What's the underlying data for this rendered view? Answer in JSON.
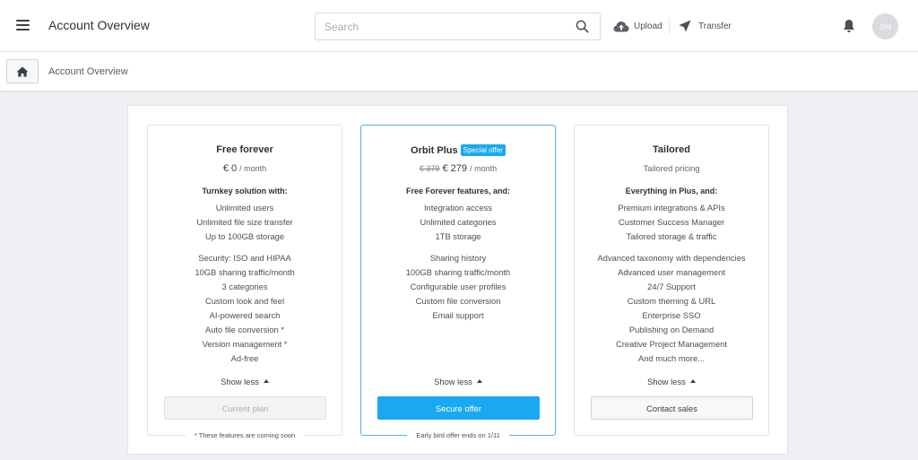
{
  "header": {
    "title": "Account Overview",
    "search_placeholder": "Search",
    "upload_label": "Upload",
    "transfer_label": "Transfer",
    "avatar_initials": "SH"
  },
  "breadcrumb": {
    "current": "Account Overview"
  },
  "colors": {
    "accent": "#1aa9f1",
    "highlight_border": "#4fb3e8"
  },
  "plans": [
    {
      "title": "Free forever",
      "price": "€ 0",
      "period": "/ month",
      "features_heading": "Turnkey solution with:",
      "group1": [
        "Unlimited users",
        "Unlimited file size transfer",
        "Up to 100GB storage"
      ],
      "group2": [
        "Security: ISO and HIPAA",
        "10GB sharing traffic/month",
        "3 categories",
        "Custom look and feel",
        "AI-powered search",
        "Auto file conversion *",
        "Version management *",
        "Ad-free"
      ],
      "show_less": "Show less",
      "button": "Current plan",
      "footnote": "* These features are coming soon"
    },
    {
      "title": "Orbit Plus",
      "badge": "Special offer",
      "old_price": "€ 379",
      "price": "€ 279",
      "period": "/ month",
      "features_heading": "Free Forever features, and:",
      "group1": [
        "Integration access",
        "Unlimited categories",
        "1TB storage"
      ],
      "group2": [
        "Sharing history",
        "100GB sharing traffic/month",
        "Configurable user profiles",
        "Custom file conversion",
        "Email support"
      ],
      "show_less": "Show less",
      "button": "Secure offer",
      "footnote": "Early bird offer ends on 1/11"
    },
    {
      "title": "Tailored",
      "price": "Tailored pricing",
      "features_heading": "Everything in Plus, and:",
      "group1": [
        "Premium integrations & APIs",
        "Customer Success Manager",
        "Tailored storage & traffic"
      ],
      "group2": [
        "Advanced taxonomy with dependencies",
        "Advanced user management",
        "24/7 Support",
        "Custom theming & URL",
        "Enterprise SSO",
        "Publishing on Demand",
        "Creative Project Management",
        "And much more..."
      ],
      "show_less": "Show less",
      "button": "Contact sales"
    }
  ]
}
